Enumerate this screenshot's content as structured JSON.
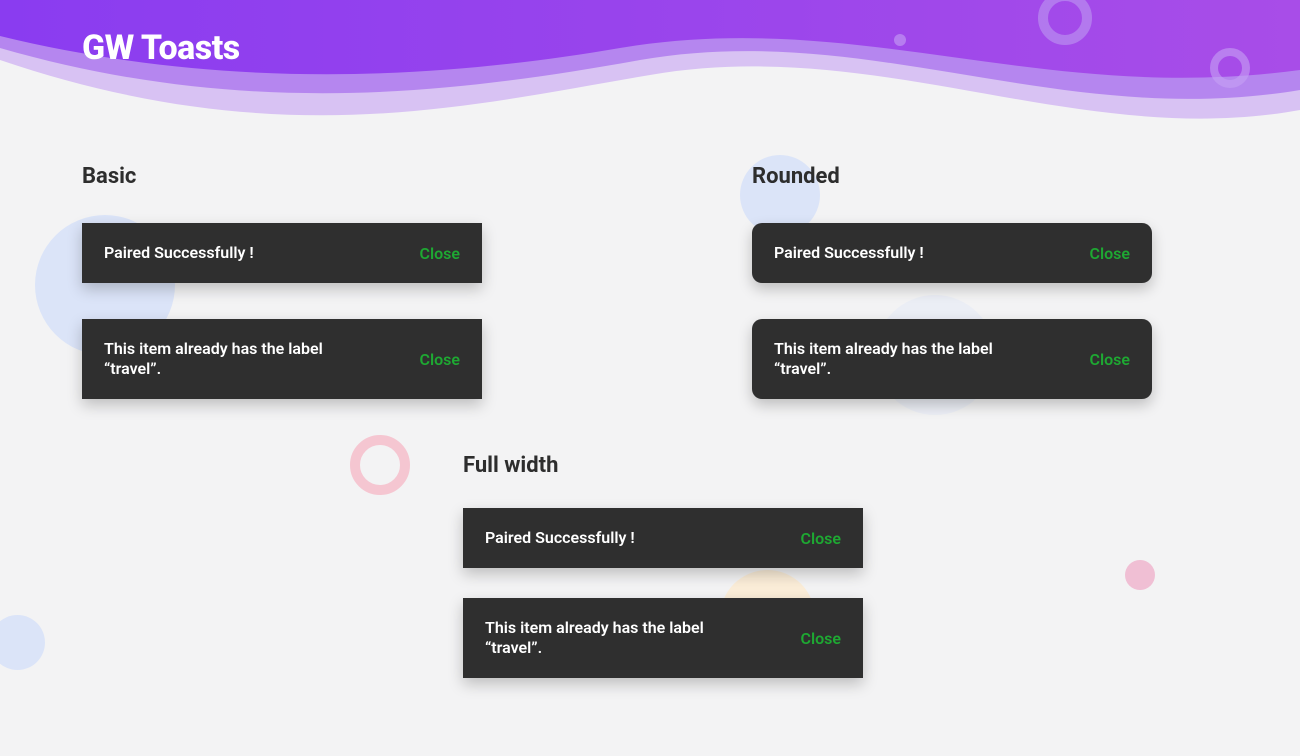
{
  "header": {
    "title": "GW Toasts"
  },
  "sections": {
    "basic": {
      "title": "Basic",
      "toasts": [
        {
          "message": "Paired Successfully !",
          "action": "Close"
        },
        {
          "message": "This item already has the label “travel”.",
          "action": "Close"
        }
      ]
    },
    "rounded": {
      "title": "Rounded",
      "toasts": [
        {
          "message": "Paired Successfully !",
          "action": "Close"
        },
        {
          "message": "This item already has the label “travel”.",
          "action": "Close"
        }
      ]
    },
    "fullwidth": {
      "title": "Full width",
      "toasts": [
        {
          "message": "Paired Successfully !",
          "action": "Close"
        },
        {
          "message": "This item already has the label “travel”.",
          "action": "Close"
        }
      ]
    }
  }
}
